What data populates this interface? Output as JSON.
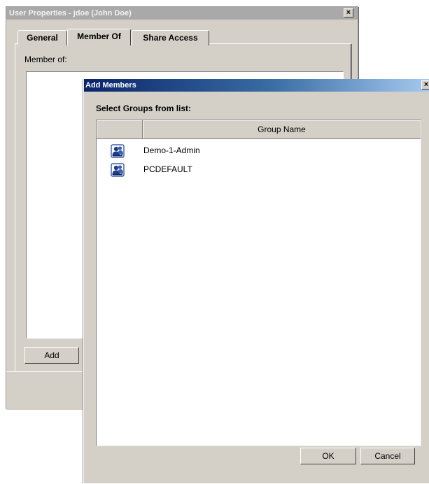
{
  "back_window": {
    "title": "User Properties - jdoe (John Doe)",
    "close_glyph": "×",
    "tabs": [
      {
        "label": "General"
      },
      {
        "label": "Member Of"
      },
      {
        "label": "Share Access"
      }
    ],
    "active_tab": "Member Of",
    "member_of_label": "Member of:",
    "add_button": "Add"
  },
  "dialog": {
    "title": "Add Members",
    "close_glyph": "×",
    "select_label": "Select Groups from list:",
    "columns": {
      "icon": "",
      "name": "Group Name"
    },
    "groups": [
      {
        "icon": "group-icon",
        "name": "Demo-1-Admin"
      },
      {
        "icon": "group-icon",
        "name": "PCDEFAULT"
      }
    ],
    "ok_button": "OK",
    "cancel_button": "Cancel"
  },
  "colors": {
    "window_face": "#d4d0c8",
    "active_title_start": "#0a246a",
    "active_title_end": "#a6caf0",
    "inactive_title": "#a9a9a9",
    "group_icon": "#1c3f8f"
  }
}
